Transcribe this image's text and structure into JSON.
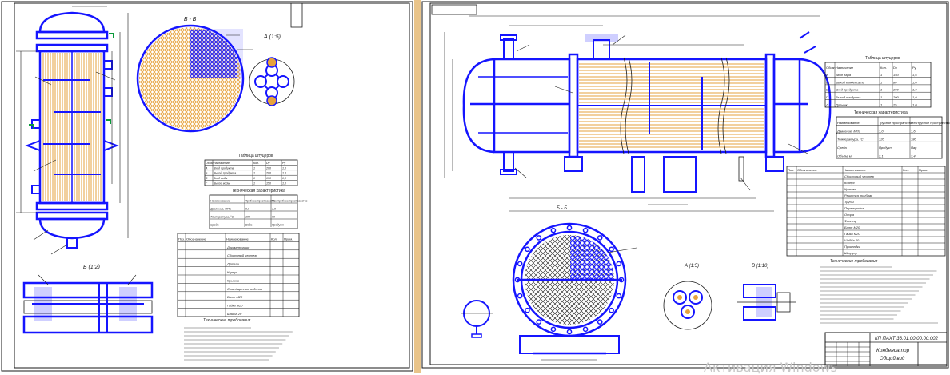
{
  "left_sheet": {
    "stamp_code": "",
    "section_aa": "Б - Б",
    "section_view": "А (1:5)",
    "section_lower": "Б (1:2)",
    "nozzle_table": {
      "title": "Таблица штуцеров",
      "headers": [
        "Обозн.",
        "Назначение",
        "Кол.",
        "Dу",
        "Pу"
      ],
      "rows": [
        [
          "А",
          "Вход продукта",
          "1",
          "200",
          "1,0"
        ],
        [
          "Б",
          "Выход продукта",
          "1",
          "200",
          "1,0"
        ],
        [
          "В",
          "Вход воды",
          "1",
          "150",
          "1,0"
        ],
        [
          "Г",
          "Выход воды",
          "1",
          "150",
          "1,0"
        ]
      ]
    },
    "tech_table": {
      "title": "Техническая характеристика",
      "headers": [
        "Наименование",
        "Трубное пространство",
        "Межтрубное пространство"
      ],
      "rows": [
        [
          "Давление, МПа",
          "0,6",
          "1,0"
        ],
        [
          "Температура, °С",
          "100",
          "60"
        ],
        [
          "Среда",
          "Вода",
          "Продукт"
        ]
      ]
    },
    "spec_table": {
      "headers": [
        "Поз.",
        "Обозначение",
        "Наименование",
        "Кол.",
        "Прим."
      ],
      "rows": [
        "Документация",
        "Сборочный чертеж",
        "Детали",
        "Корпус",
        "Крышка",
        "Стандартные изделия",
        "Болт М20",
        "Гайка М20",
        "Шайба 20"
      ]
    },
    "notes_title": "Технические требования"
  },
  "right_sheet": {
    "stamp_code": "",
    "section_label": "Б - Б",
    "detail_a": "А (1:5)",
    "detail_b": "В (1:10)",
    "nozzle_table": {
      "title": "Таблица штуцеров",
      "headers": [
        "Обозн.",
        "Назначение",
        "Кол.",
        "Dу",
        "Pу"
      ],
      "rows": [
        [
          "А",
          "Вход пара",
          "1",
          "150",
          "1,6"
        ],
        [
          "Б",
          "Выход конденсата",
          "1",
          "80",
          "1,6"
        ],
        [
          "В",
          "Вход продукта",
          "1",
          "200",
          "1,0"
        ],
        [
          "Г",
          "Выход продукта",
          "1",
          "200",
          "1,0"
        ],
        [
          "Д",
          "Дренаж",
          "1",
          "25",
          "1,0"
        ]
      ]
    },
    "tech_table": {
      "title": "Техническая характеристика",
      "headers": [
        "Наименование",
        "Трубное пространство",
        "Межтрубное пространство"
      ],
      "rows": [
        [
          "Давление, МПа",
          "1,0",
          "1,6"
        ],
        [
          "Температура, °С",
          "120",
          "180"
        ],
        [
          "Среда",
          "Продукт",
          "Пар"
        ],
        [
          "Объём, м³",
          "2,1",
          "3,4"
        ]
      ]
    },
    "spec_table": {
      "headers": [
        "Поз.",
        "Обозначение",
        "Наименование",
        "Кол.",
        "Прим."
      ],
      "rows": [
        "Сборочный чертеж",
        "Корпус",
        "Крышка",
        "Решетка трубная",
        "Трубы",
        "Перегородка",
        "Опора",
        "Фланец",
        "Болт М20",
        "Гайка М20",
        "Шайба 20",
        "Прокладка",
        "Штуцер"
      ]
    },
    "notes_title": "Технические требования",
    "title_block": {
      "code": "КП ПАХТ 36.01.00.00.00.002",
      "name": "Конденсатор",
      "subtitle": "Общий вид",
      "sheet_no": ""
    }
  },
  "watermark": "Активация Windows",
  "colors": {
    "outline": "#1515ff",
    "tubes": "#e6a23c",
    "line": "#1a1a1a",
    "gap": "#e9c48a"
  }
}
